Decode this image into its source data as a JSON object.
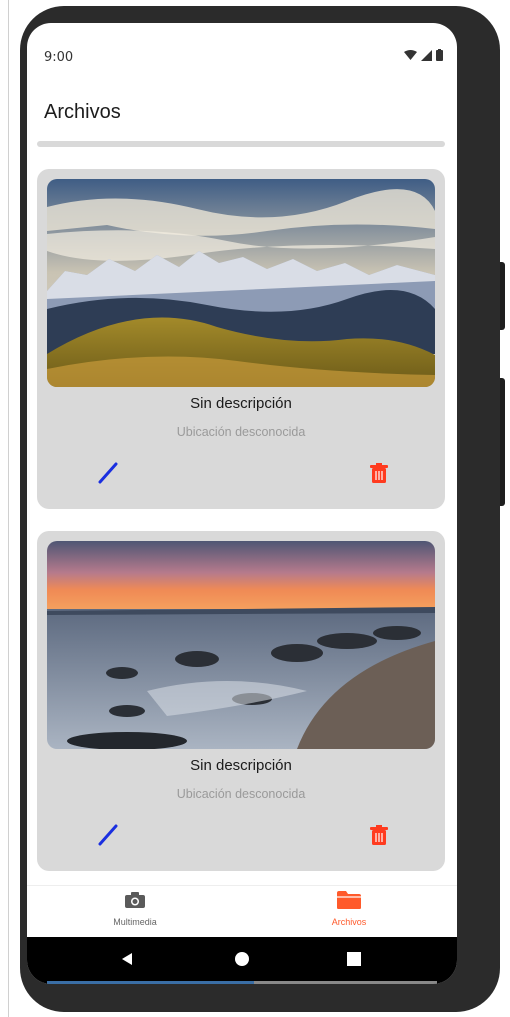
{
  "status_bar": {
    "time": "9:00"
  },
  "appbar": {
    "title": "Archivos"
  },
  "cards": [
    {
      "description": "Sin descripción",
      "location": "Ubicación desconocida",
      "image": "mountain-landscape"
    },
    {
      "description": "Sin descripción",
      "location": "Ubicación desconocida",
      "image": "seaside-sunset"
    }
  ],
  "bottom_nav": {
    "items": [
      {
        "label": "Multimedia",
        "icon": "camera-icon",
        "active": false
      },
      {
        "label": "Archivos",
        "icon": "folder-icon",
        "active": true
      }
    ]
  },
  "colors": {
    "accent": "#ff5a2b",
    "edit": "#1a2fe0",
    "delete": "#ff3b1f",
    "card": "#d9d9d9"
  }
}
